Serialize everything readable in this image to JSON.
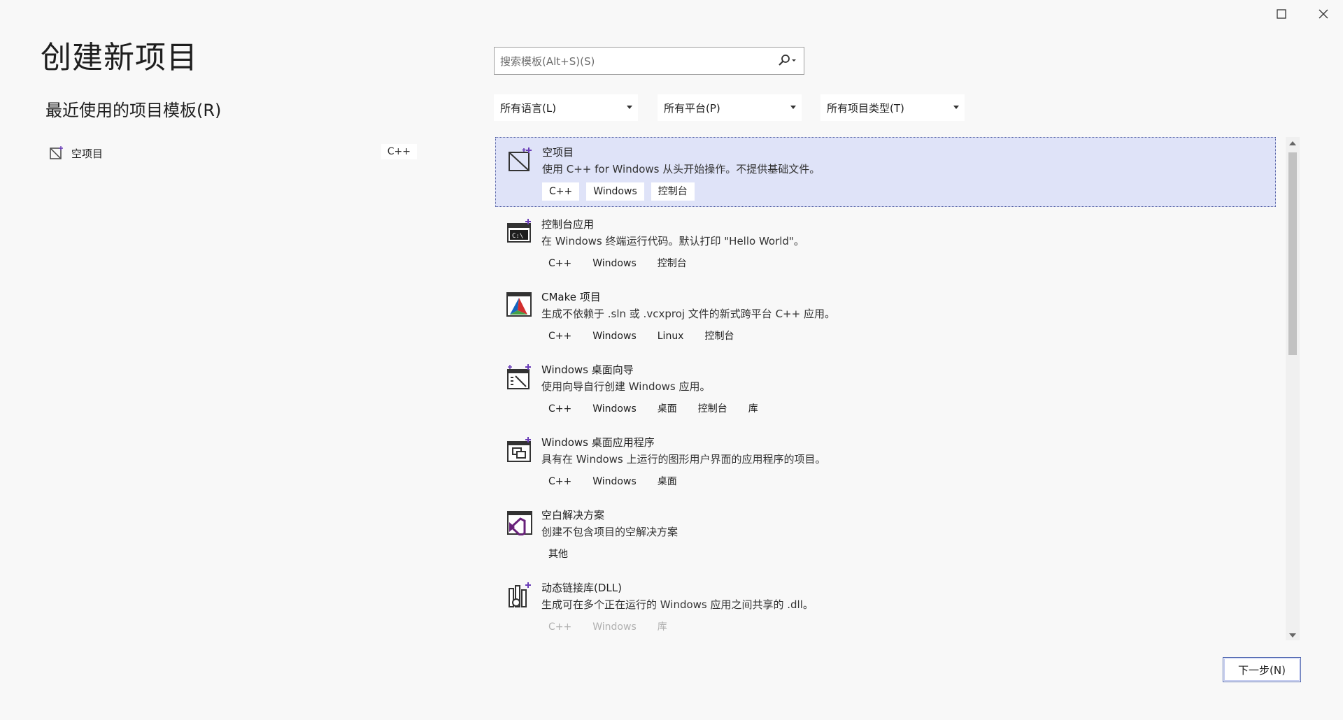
{
  "window": {
    "maximize_icon": "maximize-icon",
    "close_icon": "close-icon"
  },
  "page": {
    "title": "创建新项目"
  },
  "recent": {
    "title": "最近使用的项目模板(R)",
    "items": [
      {
        "label": "空项目",
        "tag": "C++",
        "icon": "empty-project-icon"
      }
    ]
  },
  "search": {
    "placeholder": "搜索模板(Alt+S)(S)",
    "icon": "search-icon"
  },
  "filters": [
    {
      "label": "所有语言(L)"
    },
    {
      "label": "所有平台(P)"
    },
    {
      "label": "所有项目类型(T)"
    }
  ],
  "templates": [
    {
      "title": "空项目",
      "desc": "使用 C++ for Windows 从头开始操作。不提供基础文件。",
      "tags": [
        "C++",
        "Windows",
        "控制台"
      ],
      "icon": "empty-project-icon",
      "selected": true
    },
    {
      "title": "控制台应用",
      "desc": "在 Windows 终端运行代码。默认打印 \"Hello World\"。",
      "tags": [
        "C++",
        "Windows",
        "控制台"
      ],
      "icon": "console-app-icon"
    },
    {
      "title": "CMake 项目",
      "desc": "生成不依赖于 .sln 或 .vcxproj 文件的新式跨平台 C++ 应用。",
      "tags": [
        "C++",
        "Windows",
        "Linux",
        "控制台"
      ],
      "icon": "cmake-icon"
    },
    {
      "title": "Windows 桌面向导",
      "desc": "使用向导自行创建 Windows 应用。",
      "tags": [
        "C++",
        "Windows",
        "桌面",
        "控制台",
        "库"
      ],
      "icon": "desktop-wizard-icon"
    },
    {
      "title": "Windows 桌面应用程序",
      "desc": "具有在 Windows 上运行的图形用户界面的应用程序的项目。",
      "tags": [
        "C++",
        "Windows",
        "桌面"
      ],
      "icon": "desktop-app-icon"
    },
    {
      "title": "空白解决方案",
      "desc": "创建不包含项目的空解决方案",
      "tags": [
        "其他"
      ],
      "icon": "blank-solution-icon"
    },
    {
      "title": "动态链接库(DLL)",
      "desc": "生成可在多个正在运行的 Windows 应用之间共享的 .dll。",
      "tags": [
        "C++",
        "Windows",
        "库"
      ],
      "icon": "dll-icon"
    }
  ],
  "footer": {
    "next_label": "下一步(N)"
  },
  "colors": {
    "selected_bg": "#dfe3f8",
    "accent": "#4b63b0"
  }
}
